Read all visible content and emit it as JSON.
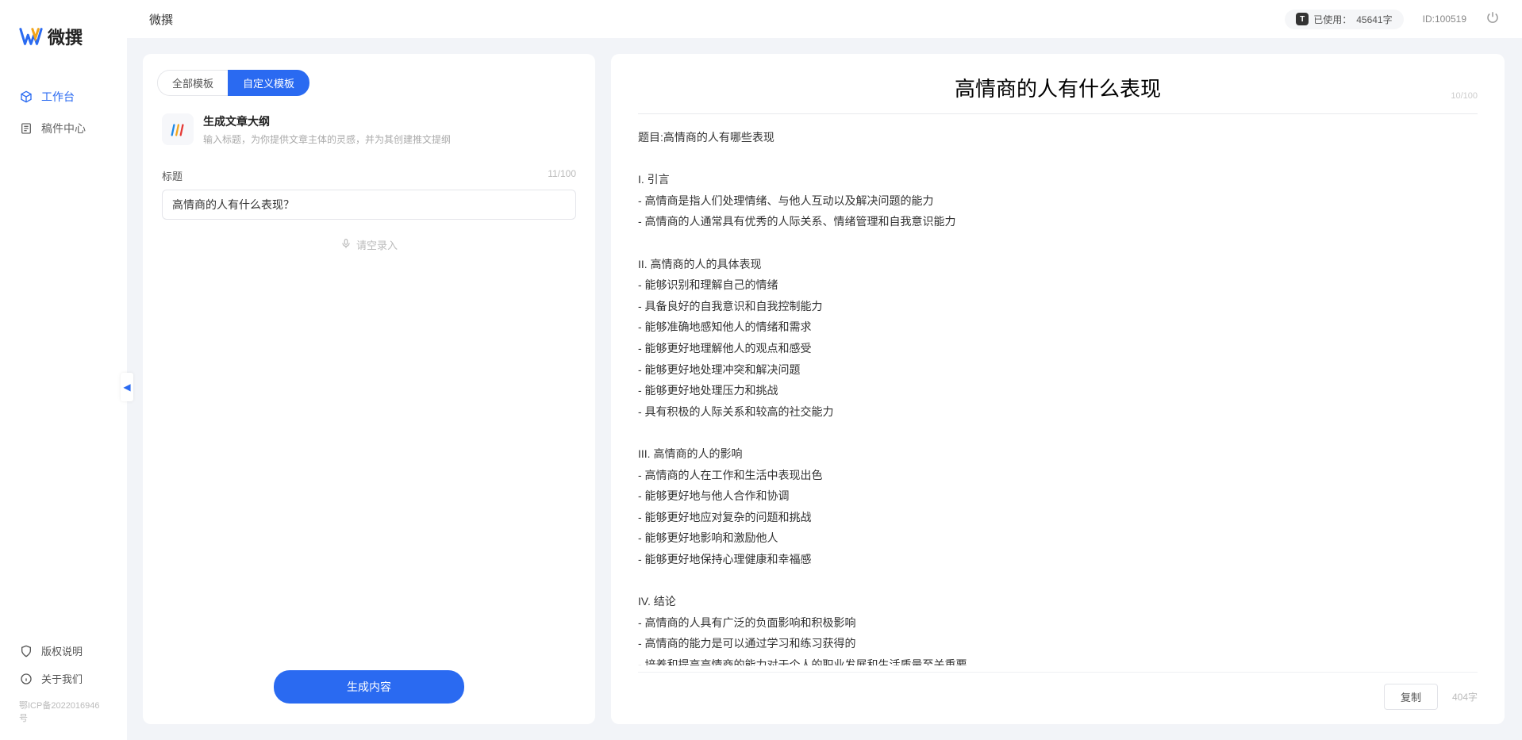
{
  "app": {
    "name": "微撰",
    "logo_text": "微撰"
  },
  "sidebar": {
    "nav": [
      {
        "label": "工作台",
        "active": true
      },
      {
        "label": "稿件中心",
        "active": false
      }
    ],
    "bottom": [
      {
        "label": "版权说明"
      },
      {
        "label": "关于我们"
      }
    ],
    "icp": "鄂ICP备2022016946号"
  },
  "topbar": {
    "title": "微撰",
    "usage_badge": "T",
    "usage_label": "已使用：",
    "usage_value": "45641字",
    "id_label": "ID:100519"
  },
  "tabs": {
    "all": "全部模板",
    "custom": "自定义模板"
  },
  "template": {
    "title": "生成文章大纲",
    "desc": "输入标题，为你提供文章主体的灵感，并为其创建推文提纲"
  },
  "field": {
    "label": "标题",
    "count": "11/100",
    "value": "高情商的人有什么表现？",
    "voice_hint": "请空录入"
  },
  "generate_label": "生成内容",
  "output": {
    "title": "高情商的人有什么表现",
    "title_counter": "10/100",
    "body": "题目:高情商的人有哪些表现\n\nI. 引言\n- 高情商是指人们处理情绪、与他人互动以及解决问题的能力\n- 高情商的人通常具有优秀的人际关系、情绪管理和自我意识能力\n\nII. 高情商的人的具体表现\n- 能够识别和理解自己的情绪\n- 具备良好的自我意识和自我控制能力\n- 能够准确地感知他人的情绪和需求\n- 能够更好地理解他人的观点和感受\n- 能够更好地处理冲突和解决问题\n- 能够更好地处理压力和挑战\n- 具有积极的人际关系和较高的社交能力\n\nIII. 高情商的人的影响\n- 高情商的人在工作和生活中表现出色\n- 能够更好地与他人合作和协调\n- 能够更好地应对复杂的问题和挑战\n- 能够更好地影响和激励他人\n- 能够更好地保持心理健康和幸福感\n\nIV. 结论\n- 高情商的人具有广泛的负面影响和积极影响\n- 高情商的能力是可以通过学习和练习获得的\n- 培养和提高高情商的能力对于个人的职业发展和生活质量至关重要。",
    "copy_label": "复制",
    "word_count": "404字"
  }
}
